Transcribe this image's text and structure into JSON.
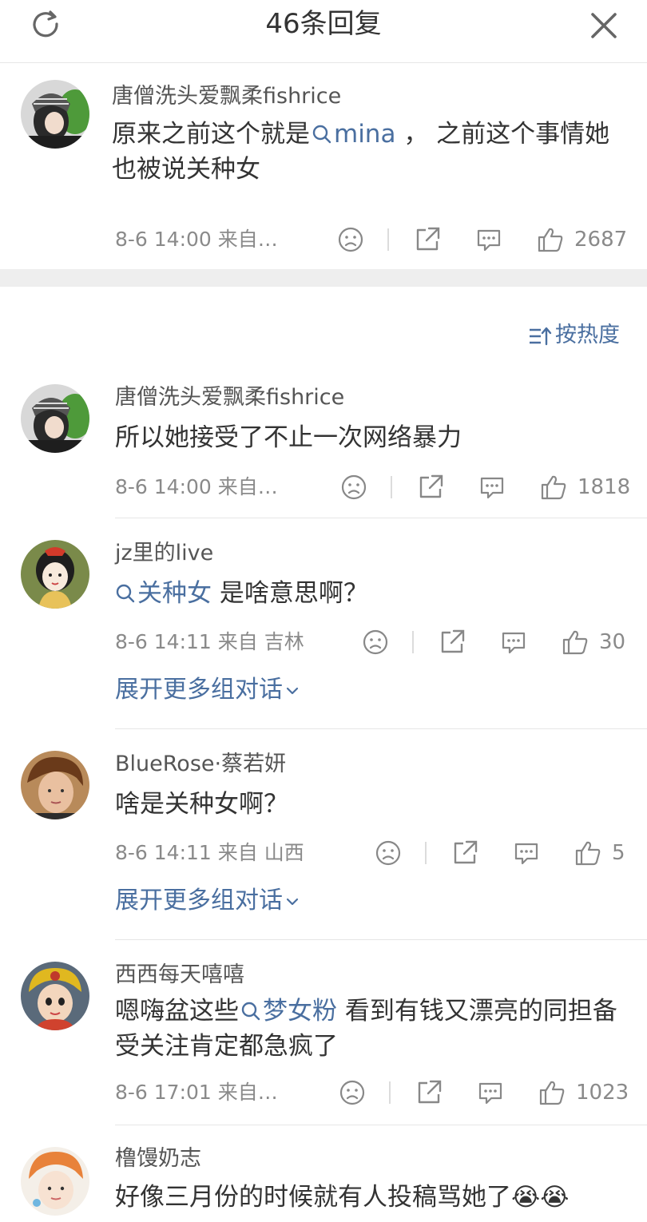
{
  "header": {
    "title": "46条回复"
  },
  "sort": {
    "label": "按热度"
  },
  "main_comment": {
    "user": "唐僧洗头爱飘柔fishrice",
    "text_before": "原来之前这个就是",
    "tag": "mina",
    "text_after": "， 之前这个事情她也被说关种女",
    "time": "8-6 14:00",
    "source": "来自…",
    "likes": "2687"
  },
  "replies": [
    {
      "user": "唐僧洗头爱飘柔fishrice",
      "text": "所以她接受了不止一次网络暴力",
      "time": "8-6 14:00",
      "source": "来自…",
      "likes": "1818"
    },
    {
      "user": "jz里的live",
      "tag": "关种女",
      "text": "是啥意思啊？",
      "time": "8-6 14:11",
      "source": "来自 吉林",
      "likes": "30",
      "expand": "展开更多组对话"
    },
    {
      "user": "BlueRose·蔡若妍",
      "text": "啥是关种女啊？",
      "time": "8-6 14:11",
      "source": "来自 山西",
      "likes": "5",
      "expand": "展开更多组对话"
    },
    {
      "user": "西西每天嘻嘻",
      "text_before": "嗯嗨盆这些",
      "tag": "梦女粉",
      "text_after": "看到有钱又漂亮的同担备受关注肯定都急疯了",
      "time": "8-6 17:01",
      "source": "来自…",
      "likes": "1023"
    },
    {
      "user": "橹馒奶志",
      "text": "好像三月份的时候就有人投稿骂她了😭😭"
    }
  ],
  "icons": [
    "refresh-icon",
    "close-icon",
    "sort-icon",
    "sad-face-icon",
    "share-icon",
    "comment-icon",
    "thumbs-up-icon",
    "chevron-down-icon",
    "search-tag-icon"
  ],
  "colors": {
    "accent": "#4a6fa0",
    "meta": "#8a8a8a",
    "text": "#333333"
  }
}
